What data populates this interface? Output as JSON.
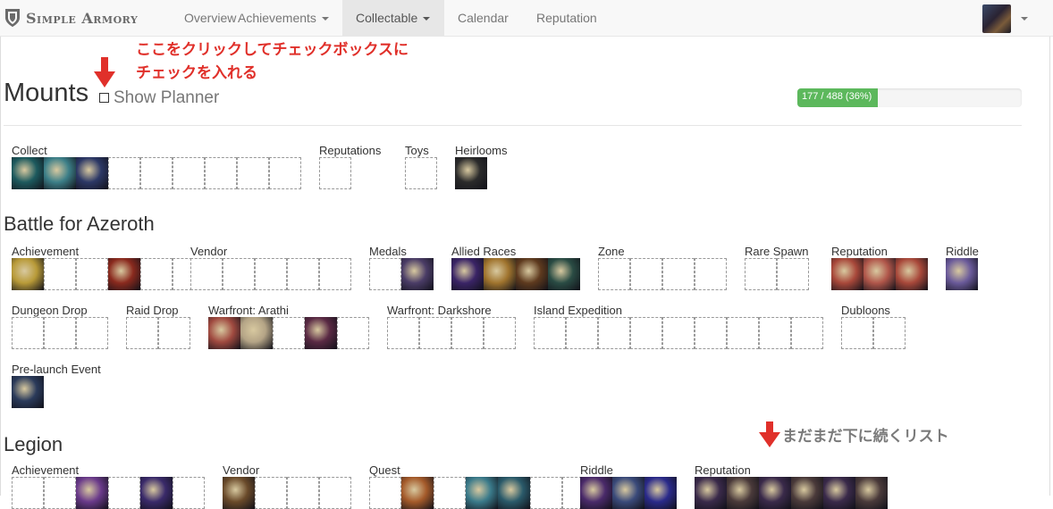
{
  "nav": {
    "brand": "Simple Armory",
    "items": [
      "Overview",
      "Achievements",
      "Collectable",
      "Calendar",
      "Reputation"
    ]
  },
  "annotations": {
    "instruction_line1": "ここをクリックしてチェックボックスに",
    "instruction_line2": "チェックを入れる",
    "more_below": "まだまだ下に続くリスト"
  },
  "header": {
    "title": "Mounts",
    "planner_label": "Show Planner",
    "planner_checked": false,
    "progress_text": "177 / 488 (36%)",
    "progress_fraction": 0.36
  },
  "colors": {
    "progress": "#5cb85c",
    "annotation_red": "#e0302a",
    "slot_border": "#999999"
  },
  "top_categories": [
    {
      "label": "Collect",
      "slots": [
        "#1d5a5e",
        "#3c7f88",
        "#2c3866",
        "",
        "",
        "",
        "",
        "",
        ""
      ]
    },
    {
      "label": "Reputations",
      "slots": [
        ""
      ]
    },
    {
      "label": "Toys",
      "slots": [
        ""
      ]
    },
    {
      "label": "Heirlooms",
      "slots": [
        "#2b2b2b"
      ]
    }
  ],
  "sections": [
    {
      "title": "Battle for Azeroth",
      "rows": [
        [
          {
            "label": "Achievement",
            "slots": [
              "#b89a38",
              "",
              "",
              "#8a2a1e",
              "",
              ""
            ]
          },
          {
            "label": "Vendor",
            "slots": [
              "",
              "",
              "",
              "",
              ""
            ]
          },
          {
            "label": "Medals",
            "slots": [
              "",
              "#4a3c66"
            ]
          },
          {
            "label": "Allied Races",
            "slots": [
              "#3a2466",
              "#a0742e",
              "#5e3a1e",
              "#2a4c44"
            ]
          },
          {
            "label": "Zone",
            "slots": [
              "",
              "",
              "",
              ""
            ]
          },
          {
            "label": "Rare Spawn",
            "slots": [
              "",
              ""
            ]
          },
          {
            "label": "Reputation",
            "slots": [
              "#a8483a",
              "#b0564a",
              "#a8483a"
            ]
          },
          {
            "label": "Riddle",
            "slots": [
              "#6a5a9a"
            ]
          }
        ],
        [
          {
            "label": "Dungeon Drop",
            "slots": [
              "",
              "",
              ""
            ]
          },
          {
            "label": "Raid Drop",
            "slots": [
              "",
              ""
            ]
          },
          {
            "label": "Warfront: Arathi",
            "slots": [
              "#a04a40",
              "#b4a486",
              "",
              "#5a2a44",
              ""
            ]
          },
          {
            "label": "Warfront: Darkshore",
            "slots": [
              "",
              "",
              "",
              ""
            ]
          },
          {
            "label": "Island Expedition",
            "slots": [
              "",
              "",
              "",
              "",
              "",
              "",
              "",
              "",
              ""
            ]
          },
          {
            "label": "Dubloons",
            "slots": [
              "",
              ""
            ]
          }
        ],
        [
          {
            "label": "Pre-launch Event",
            "slots": [
              "#2a3a5a"
            ]
          }
        ]
      ]
    },
    {
      "title": "Legion",
      "rows": [
        [
          {
            "label": "Achievement",
            "slots": [
              "",
              "",
              "#6a3a8a",
              "",
              "#3a2a6a",
              ""
            ]
          },
          {
            "label": "Vendor",
            "slots": [
              "#6a4a2a",
              "",
              "",
              ""
            ]
          },
          {
            "label": "Quest",
            "slots": [
              "",
              "#a45a2a",
              "",
              "#3a7a8a",
              "#2a5a6a",
              "",
              ""
            ]
          },
          {
            "label": "Riddle",
            "slots": [
              "#4a2a6a",
              "#3a4a7a",
              "#2a2a8a"
            ]
          },
          {
            "label": "Reputation",
            "slots": [
              "#3a2a4a",
              "#4a3a3a",
              "#3a2a4a",
              "#4a3a3a",
              "#3a2a4a",
              "#4a3a3a"
            ]
          }
        ]
      ]
    }
  ]
}
